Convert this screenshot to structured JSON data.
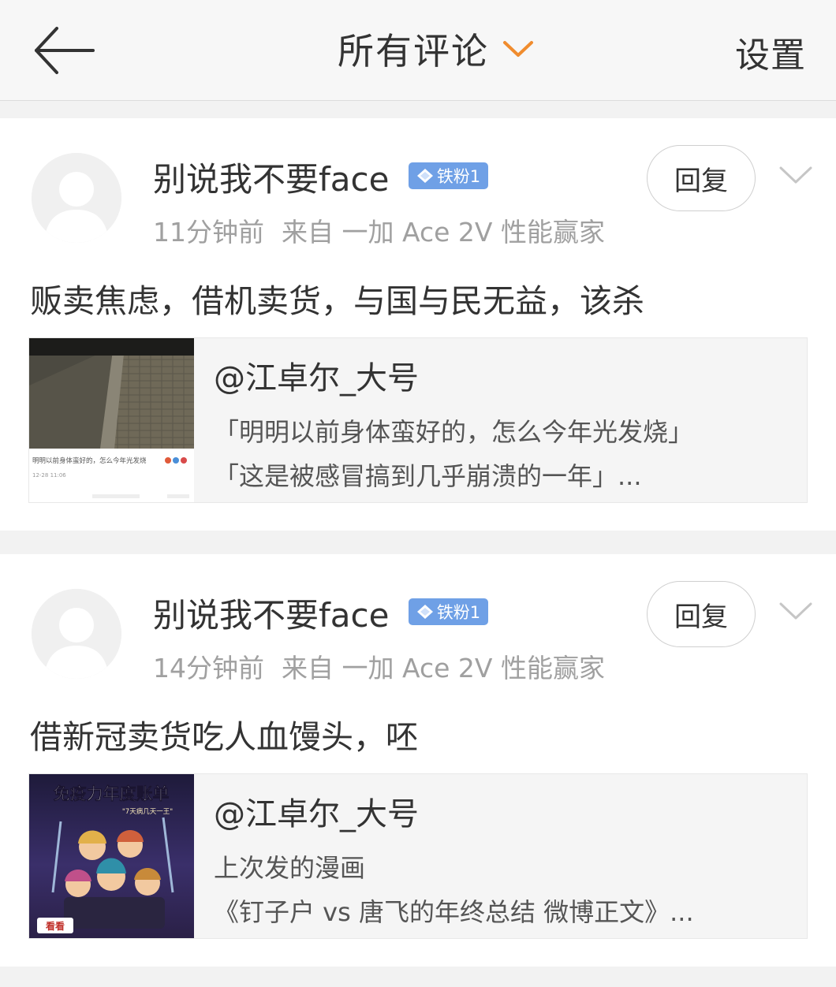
{
  "header": {
    "back_icon": "arrow-left-icon",
    "title": "所有评论",
    "title_icon": "chevron-down-icon",
    "title_icon_color": "#f08c2e",
    "settings_label": "设置"
  },
  "comments": [
    {
      "username": "别说我不要face",
      "badge": "铁粉1",
      "badge_color": "#6fa0e6",
      "time": "11分钟前",
      "source": "来自 一加 Ace 2V 性能赢家",
      "reply_label": "回复",
      "content": "贩卖焦虑，借机卖货，与国与民无益，该杀",
      "quote": {
        "author": "@江卓尔_大号",
        "line1": "「明明以前身体蛮好的，怎么今年光发烧」",
        "line2": "「这是被感冒搞到几乎崩溃的一年」...",
        "thumb_caption": "明明以前身体蛮好的，怎么今年光发烧",
        "thumb_date": "12-28 11:06"
      }
    },
    {
      "username": "别说我不要face",
      "badge": "铁粉1",
      "badge_color": "#6fa0e6",
      "time": "14分钟前",
      "source": "来自 一加 Ace 2V 性能赢家",
      "reply_label": "回复",
      "content": "借新冠卖货吃人血馒头，呸",
      "quote": {
        "author": "@江卓尔_大号",
        "line1": "上次发的漫画",
        "line2": "《钉子户 vs  唐飞的年终总结 微博正文》...",
        "thumb_title": "免疫力年度账单",
        "thumb_subtitle": "\"7天病几天一王\"",
        "thumb_tag": "看看"
      }
    }
  ]
}
